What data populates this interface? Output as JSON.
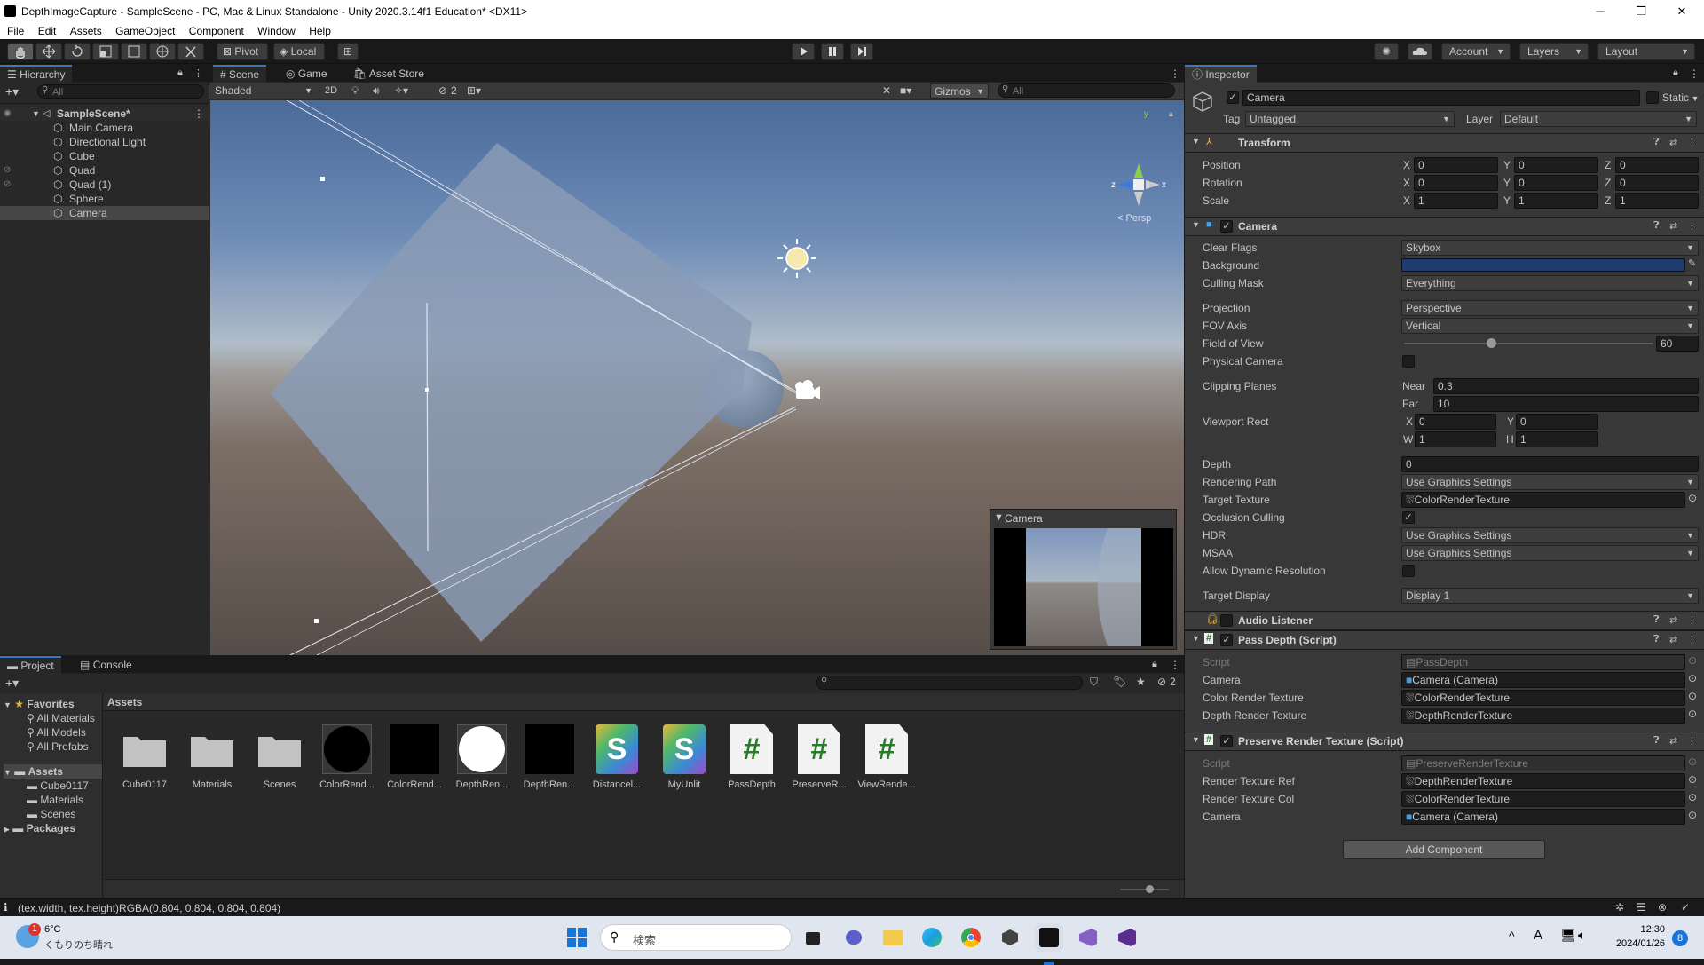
{
  "window": {
    "title": "DepthImageCapture - SampleScene - PC, Mac & Linux Standalone - Unity 2020.3.14f1 Education* <DX11>",
    "minimize": "─",
    "maximize": "❐",
    "close": "✕"
  },
  "menu": [
    "File",
    "Edit",
    "Assets",
    "GameObject",
    "Component",
    "Window",
    "Help"
  ],
  "toolbar": {
    "pivot": "Pivot",
    "local": "Local",
    "account": "Account",
    "layers": "Layers",
    "layout": "Layout"
  },
  "hierarchy": {
    "tab": "Hierarchy",
    "search_placeholder": "All",
    "scene": "SampleScene*",
    "items": [
      "Main Camera",
      "Directional Light",
      "Cube",
      "Quad",
      "Quad (1)",
      "Sphere",
      "Camera"
    ],
    "selected": "Camera"
  },
  "scene_view": {
    "tabs": [
      "Scene",
      "Game",
      "Asset Store"
    ],
    "shading": "Shaded",
    "mode_2d": "2D",
    "hidden_count": "2",
    "gizmos": "Gizmos",
    "search_placeholder": "All",
    "persp": "< Persp",
    "gizmo_axes": {
      "y": "y",
      "z": "z",
      "x": "x"
    },
    "camera_preview_title": "Camera"
  },
  "project": {
    "tabs": [
      "Project",
      "Console"
    ],
    "favorites_label": "Favorites",
    "favorites": [
      "All Materials",
      "All Models",
      "All Prefabs"
    ],
    "assets_label": "Assets",
    "asset_folders": [
      "Cube0117",
      "Materials",
      "Scenes"
    ],
    "packages_label": "Packages",
    "breadcrumb": "Assets",
    "hidden_count": "2",
    "items": [
      {
        "label": "Cube0117",
        "kind": "folder"
      },
      {
        "label": "Materials",
        "kind": "folder"
      },
      {
        "label": "Scenes",
        "kind": "folder"
      },
      {
        "label": "ColorRend...",
        "kind": "black-circle"
      },
      {
        "label": "ColorRend...",
        "kind": "black-square"
      },
      {
        "label": "DepthRen...",
        "kind": "white-circle"
      },
      {
        "label": "DepthRen...",
        "kind": "black-square"
      },
      {
        "label": "Distancel...",
        "kind": "shader"
      },
      {
        "label": "MyUnlit",
        "kind": "shader"
      },
      {
        "label": "PassDepth",
        "kind": "script"
      },
      {
        "label": "PreserveR...",
        "kind": "script"
      },
      {
        "label": "ViewRende...",
        "kind": "script"
      }
    ]
  },
  "status_bar": {
    "message": "(tex.width, tex.height)RGBA(0.804, 0.804, 0.804, 0.804)"
  },
  "inspector": {
    "tab": "Inspector",
    "object_name": "Camera",
    "static_label": "Static",
    "tag_label": "Tag",
    "tag_value": "Untagged",
    "layer_label": "Layer",
    "layer_value": "Default",
    "transform": {
      "title": "Transform",
      "rows": [
        {
          "label": "Position",
          "x": "0",
          "y": "0",
          "z": "0"
        },
        {
          "label": "Rotation",
          "x": "0",
          "y": "0",
          "z": "0"
        },
        {
          "label": "Scale",
          "x": "1",
          "y": "1",
          "z": "1"
        }
      ]
    },
    "camera": {
      "title": "Camera",
      "clear_flags_label": "Clear Flags",
      "clear_flags": "Skybox",
      "background_label": "Background",
      "background_color": "#1f3c6e",
      "culling_mask_label": "Culling Mask",
      "culling_mask": "Everything",
      "projection_label": "Projection",
      "projection": "Perspective",
      "fov_axis_label": "FOV Axis",
      "fov_axis": "Vertical",
      "fov_label": "Field of View",
      "fov": "60",
      "fov_fraction": 0.35,
      "physical_label": "Physical Camera",
      "clipping_label": "Clipping Planes",
      "near_label": "Near",
      "near": "0.3",
      "far_label": "Far",
      "far": "10",
      "viewport_label": "Viewport Rect",
      "vx": "0",
      "vy": "0",
      "vw": "1",
      "vh": "1",
      "depth_label": "Depth",
      "depth": "0",
      "rendering_path_label": "Rendering Path",
      "rendering_path": "Use Graphics Settings",
      "target_texture_label": "Target Texture",
      "target_texture": "ColorRenderTexture",
      "occlusion_label": "Occlusion Culling",
      "hdr_label": "HDR",
      "hdr": "Use Graphics Settings",
      "msaa_label": "MSAA",
      "msaa": "Use Graphics Settings",
      "dynres_label": "Allow Dynamic Resolution",
      "target_display_label": "Target Display",
      "target_display": "Display 1"
    },
    "audio_listener": {
      "title": "Audio Listener"
    },
    "pass_depth": {
      "title": "Pass Depth (Script)",
      "script_label": "Script",
      "script": "PassDepth",
      "camera_label": "Camera",
      "camera": "Camera (Camera)",
      "color_rt_label": "Color Render Texture",
      "color_rt": "ColorRenderTexture",
      "depth_rt_label": "Depth Render Texture",
      "depth_rt": "DepthRenderTexture"
    },
    "preserve": {
      "title": "Preserve Render Texture (Script)",
      "script_label": "Script",
      "script": "PreserveRenderTexture",
      "ref_label": "Render Texture Ref",
      "ref": "DepthRenderTexture",
      "col_label": "Render Texture Col",
      "col": "ColorRenderTexture",
      "camera_label": "Camera",
      "camera": "Camera (Camera)"
    },
    "add_component": "Add Component"
  },
  "taskbar": {
    "weather_temp": "6°C",
    "weather_desc": "くもりのち晴れ",
    "weather_badge": "1",
    "search_placeholder": "検索",
    "time": "12:30",
    "date": "2024/01/26",
    "ime": "A",
    "notif_count": "8"
  }
}
